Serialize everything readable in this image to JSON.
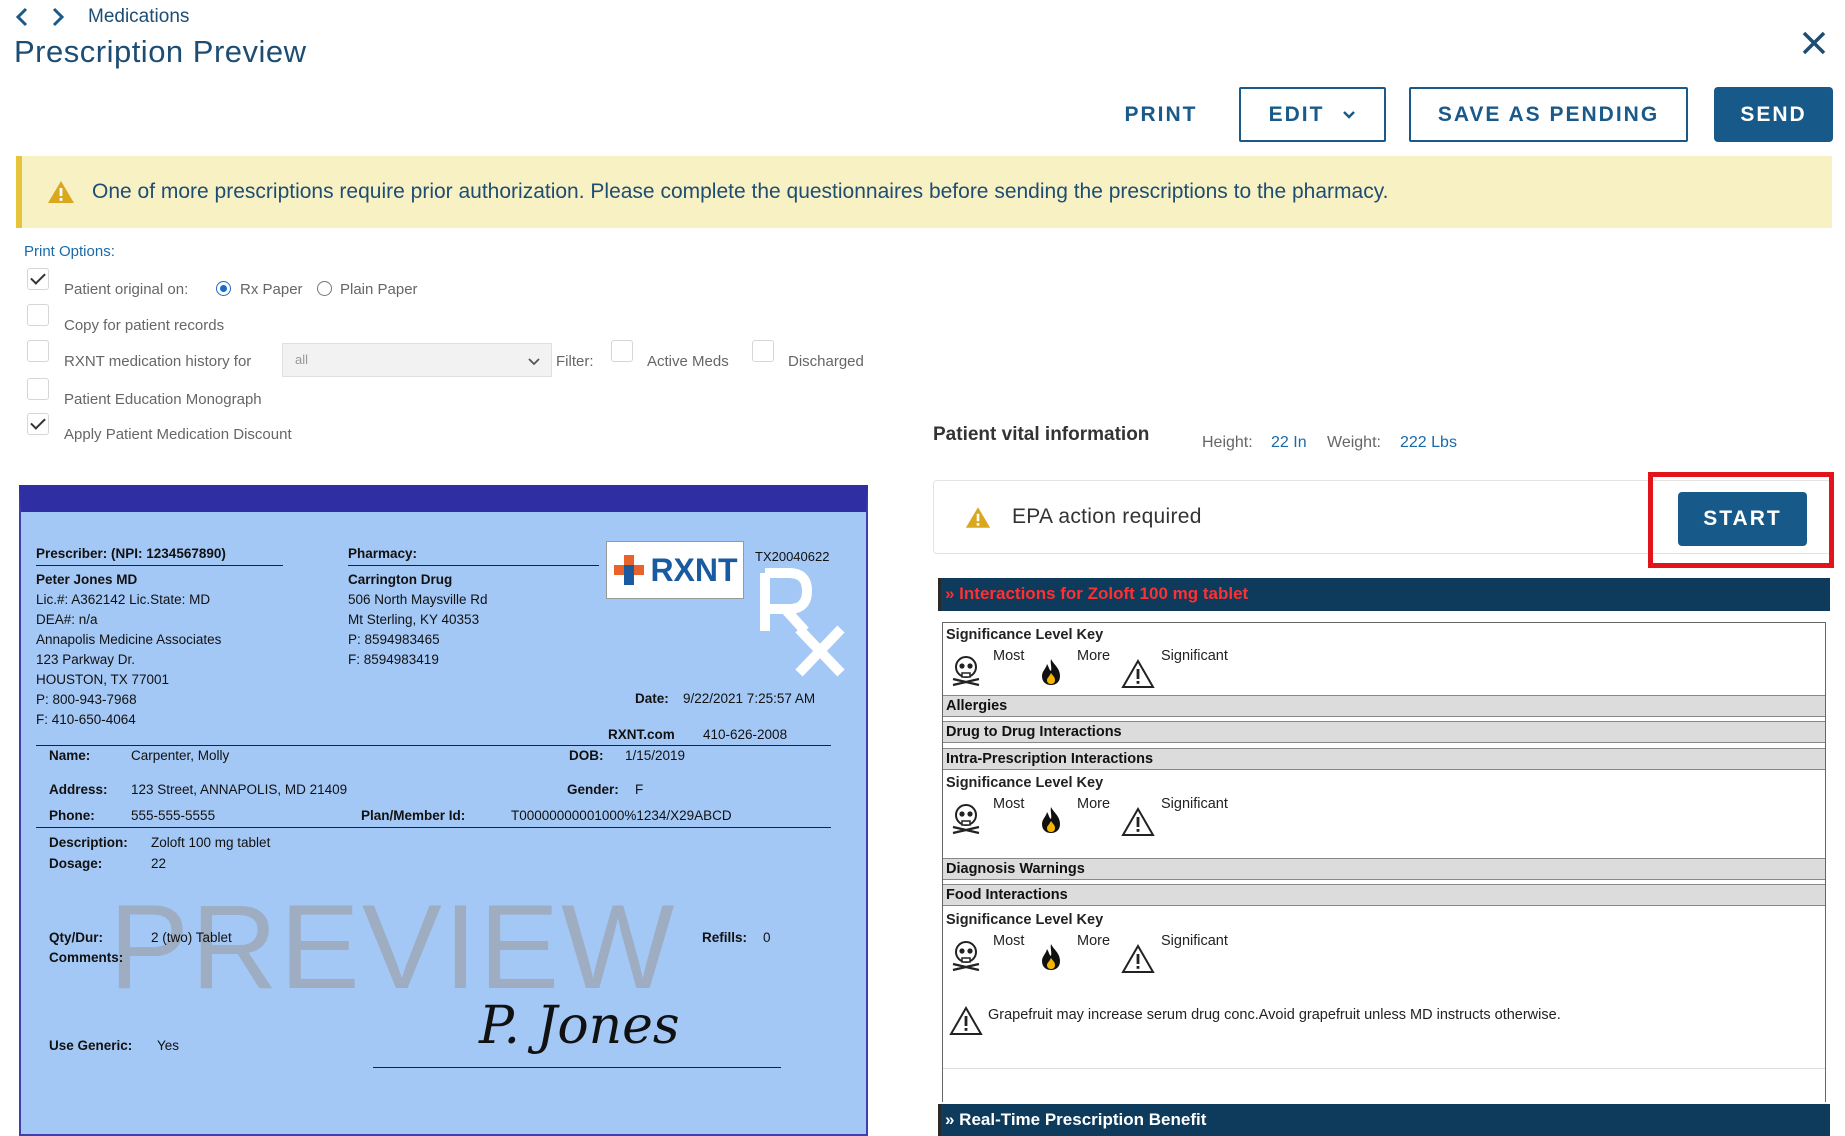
{
  "header": {
    "breadcrumb": "Medications",
    "title": "Prescription Preview"
  },
  "toolbar": {
    "print": "PRINT",
    "edit": "EDIT",
    "save_pending": "SAVE AS PENDING",
    "send": "SEND"
  },
  "banner": {
    "text": "One of more prescriptions require prior authorization. Please complete the questionnaires before sending the prescriptions to the pharmacy."
  },
  "print_options": {
    "title": "Print Options:",
    "patient_original": "Patient original on:",
    "rx_paper": "Rx Paper",
    "plain_paper": "Plain Paper",
    "copy_records": "Copy for patient records",
    "med_history": "RXNT medication history for",
    "med_history_value": "all",
    "filter": "Filter:",
    "active_meds": "Active Meds",
    "discharged": "Discharged",
    "education": "Patient Education Monograph",
    "discount": "Apply Patient Medication Discount"
  },
  "vitals": {
    "title": "Patient vital information",
    "height_label": "Height:",
    "height_value": "22 In",
    "weight_label": "Weight:",
    "weight_value": "222 Lbs"
  },
  "epa": {
    "text": "EPA action required",
    "start": "START"
  },
  "rx": {
    "prescriber_label": "Prescriber: (NPI: 1234567890)",
    "prescriber_name": "Peter Jones MD",
    "lic": "Lic.#: A362142 Lic.State: MD",
    "dea": "DEA#: n/a",
    "practice": "Annapolis Medicine Associates",
    "street": "123 Parkway Dr.",
    "city": "HOUSTON,  TX 77001",
    "phone": "P: 800-943-7968",
    "fax": "F: 410-650-4064",
    "pharmacy_label": "Pharmacy:",
    "pharmacy_name": "Carrington Drug",
    "pharmacy_street": "506 North Maysville Rd",
    "pharmacy_city": "Mt Sterling,  KY 40353",
    "pharmacy_phone": "P: 8594983465",
    "pharmacy_fax": "F: 8594983419",
    "logo_text": "RXNT",
    "tx_code": "TX20040622",
    "date_label": "Date:",
    "date_value": "9/22/2021 7:25:57 AM",
    "site": "RXNT.com",
    "site_phone": "410-626-2008",
    "name_label": "Name:",
    "name_value": "Carpenter, Molly",
    "dob_label": "DOB:",
    "dob_value": "1/15/2019",
    "address_label": "Address:",
    "address_value": "123 Street, ANNAPOLIS, MD 21409",
    "gender_label": "Gender:",
    "gender_value": "F",
    "phone_label": "Phone:",
    "phone_value": "555-555-5555",
    "plan_label": "Plan/Member Id:",
    "plan_value": "T00000000001000%1234/X29ABCD",
    "desc_label": "Description:",
    "desc_value": "Zoloft 100 mg tablet",
    "dosage_label": "Dosage:",
    "dosage_value": "22",
    "watermark": "PREVIEW",
    "qty_label": "Qty/Dur:",
    "qty_value": "2 (two) Tablet",
    "comments_label": "Comments:",
    "refills_label": "Refills:",
    "refills_value": "0",
    "generic_label": "Use Generic:",
    "generic_value": "Yes",
    "signature": "P. Jones"
  },
  "interactions": {
    "header": "» Interactions for Zoloft 100 mg tablet",
    "sig_key": "Significance Level Key",
    "most": "Most",
    "more": "More",
    "significant": "Significant",
    "allergies": "Allergies",
    "drug_drug": "Drug to Drug Interactions",
    "intra": "Intra-Prescription Interactions",
    "diagnosis": "Diagnosis Warnings",
    "food": "Food Interactions",
    "food_note": "Grapefruit may increase serum drug conc.Avoid grapefruit unless MD instructs otherwise.",
    "rtpb": "» Real-Time Prescription Benefit"
  },
  "colors": {
    "primary": "#175a8a",
    "banner_bg": "#f8f1c4",
    "warning": "#e0b52a",
    "rx_paper": "#a4c8f5",
    "highlight": "#e3131c"
  }
}
